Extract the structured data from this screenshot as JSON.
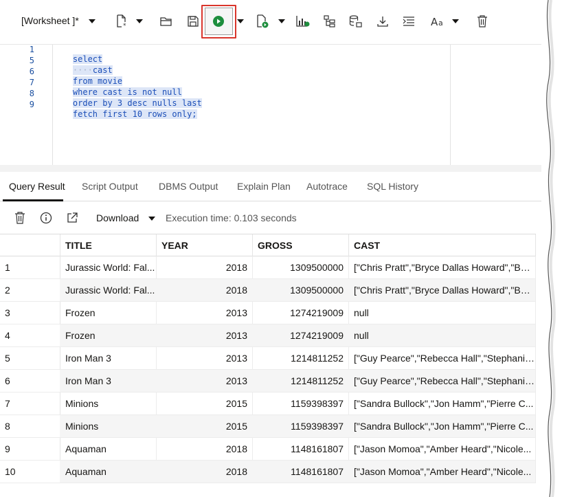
{
  "toolbar": {
    "worksheet_label": "[Worksheet ]*",
    "icons": [
      "new-worksheet-icon",
      "open-icon",
      "save-icon",
      "run-statement-icon",
      "run-script-icon",
      "explain-plan-icon",
      "autotrace-icon",
      "sql-tuning-icon",
      "download-icon",
      "format-icon",
      "case-icon",
      "clear-icon"
    ]
  },
  "editor": {
    "lines": [
      {
        "num": "1",
        "text": "select"
      },
      {
        "num": "5",
        "text": "cast"
      },
      {
        "num": "6",
        "text": "from movie"
      },
      {
        "num": "7",
        "text": "where cast is not null"
      },
      {
        "num": "8",
        "text": "order by 3 desc nulls last"
      },
      {
        "num": "9",
        "text": "fetch first 10 rows only;"
      }
    ]
  },
  "tabs": [
    "Query Result",
    "Script Output",
    "DBMS Output",
    "Explain Plan",
    "Autotrace",
    "SQL History"
  ],
  "result_toolbar": {
    "download_label": "Download",
    "execution_time": "Execution time: 0.103 seconds"
  },
  "grid": {
    "columns": [
      "TITLE",
      "YEAR",
      "GROSS",
      "CAST"
    ],
    "rows": [
      {
        "n": "1",
        "title": "Jurassic World: Fal...",
        "year": "2018",
        "gross": "1309500000",
        "cast": "[\"Chris Pratt\",\"Bryce Dallas Howard\",\"BD..."
      },
      {
        "n": "2",
        "title": "Jurassic World: Fal...",
        "year": "2018",
        "gross": "1309500000",
        "cast": "[\"Chris Pratt\",\"Bryce Dallas Howard\",\"BD..."
      },
      {
        "n": "3",
        "title": "Frozen",
        "year": "2013",
        "gross": "1274219009",
        "cast": "null"
      },
      {
        "n": "4",
        "title": "Frozen",
        "year": "2013",
        "gross": "1274219009",
        "cast": "null"
      },
      {
        "n": "5",
        "title": "Iron Man 3",
        "year": "2013",
        "gross": "1214811252",
        "cast": "[\"Guy Pearce\",\"Rebecca Hall\",\"Stephanie..."
      },
      {
        "n": "6",
        "title": "Iron Man 3",
        "year": "2013",
        "gross": "1214811252",
        "cast": "[\"Guy Pearce\",\"Rebecca Hall\",\"Stephanie..."
      },
      {
        "n": "7",
        "title": "Minions",
        "year": "2015",
        "gross": "1159398397",
        "cast": "[\"Sandra Bullock\",\"Jon Hamm\",\"Pierre C..."
      },
      {
        "n": "8",
        "title": "Minions",
        "year": "2015",
        "gross": "1159398397",
        "cast": "[\"Sandra Bullock\",\"Jon Hamm\",\"Pierre C..."
      },
      {
        "n": "9",
        "title": "Aquaman",
        "year": "2018",
        "gross": "1148161807",
        "cast": "[\"Jason Momoa\",\"Amber Heard\",\"Nicole..."
      },
      {
        "n": "10",
        "title": "Aquaman",
        "year": "2018",
        "gross": "1148161807",
        "cast": "[\"Jason Momoa\",\"Amber Heard\",\"Nicole..."
      }
    ]
  },
  "colors": {
    "highlight": "#d9342b",
    "run_green": "#1e8e3e",
    "keyword": "#1c4fb8"
  }
}
